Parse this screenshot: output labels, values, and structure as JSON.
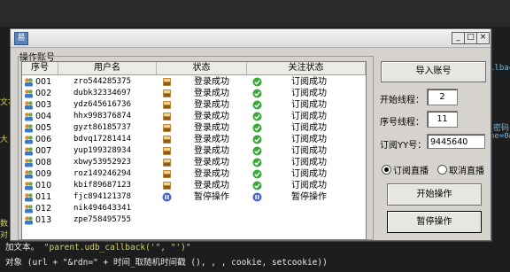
{
  "background": {
    "code_line1_prefix": "加文本。",
    "code_line1_string": "\"parent.udb_callback('\", \"')\"",
    "code_line2_prefix": "对象 (url + \"&rdn=\" + 时间_取随机时间戳 (), , , cookie, setcookie))",
    "side_snippets": [
      "llbac",
      "密码",
      "ne=0&",
      "数",
      "对",
      "大",
      "文本"
    ]
  },
  "window": {
    "minimize": "_",
    "maximize": "□",
    "close": "×",
    "icon_glyph": "易"
  },
  "group": {
    "label": "操作账号"
  },
  "table": {
    "columns": [
      "序号",
      "用户名",
      "状态",
      "关注状态"
    ],
    "rows": [
      {
        "id": "001",
        "user": "zro544285375",
        "state": "登录成功",
        "follow": "订阅成功",
        "kind": "ok"
      },
      {
        "id": "002",
        "user": "dubk32334697",
        "state": "登录成功",
        "follow": "订阅成功",
        "kind": "ok"
      },
      {
        "id": "003",
        "user": "ydz645616736",
        "state": "登录成功",
        "follow": "订阅成功",
        "kind": "ok"
      },
      {
        "id": "004",
        "user": "hhx998376874",
        "state": "登录成功",
        "follow": "订阅成功",
        "kind": "ok"
      },
      {
        "id": "005",
        "user": "gyzt86185737",
        "state": "登录成功",
        "follow": "订阅成功",
        "kind": "ok"
      },
      {
        "id": "006",
        "user": "bdvq17281414",
        "state": "登录成功",
        "follow": "订阅成功",
        "kind": "ok"
      },
      {
        "id": "007",
        "user": "yup199328934",
        "state": "登录成功",
        "follow": "订阅成功",
        "kind": "ok"
      },
      {
        "id": "008",
        "user": "xbwy53952923",
        "state": "登录成功",
        "follow": "订阅成功",
        "kind": "ok"
      },
      {
        "id": "009",
        "user": "roz149246294",
        "state": "登录成功",
        "follow": "订阅成功",
        "kind": "ok"
      },
      {
        "id": "010",
        "user": "kbif89687123",
        "state": "登录成功",
        "follow": "订阅成功",
        "kind": "ok"
      },
      {
        "id": "011",
        "user": "fjc894121378",
        "state": "暂停操作",
        "follow": "暂停操作",
        "kind": "pause"
      },
      {
        "id": "012",
        "user": "nik494643341",
        "state": "",
        "follow": "",
        "kind": "none"
      },
      {
        "id": "013",
        "user": "zpe758495755",
        "state": "",
        "follow": "",
        "kind": "none"
      }
    ]
  },
  "panel": {
    "import_button": "导入账号",
    "start_thread_label": "开始线程：",
    "start_thread_value": "2",
    "seq_thread_label": "序号线程：",
    "seq_thread_value": "11",
    "subscribe_yy_label": "订阅YY号：",
    "subscribe_yy_value": "9445640",
    "radio_subscribe": "订阅直播",
    "radio_cancel": "取消直播",
    "start_button": "开始操作",
    "pause_button": "暂停操作"
  }
}
